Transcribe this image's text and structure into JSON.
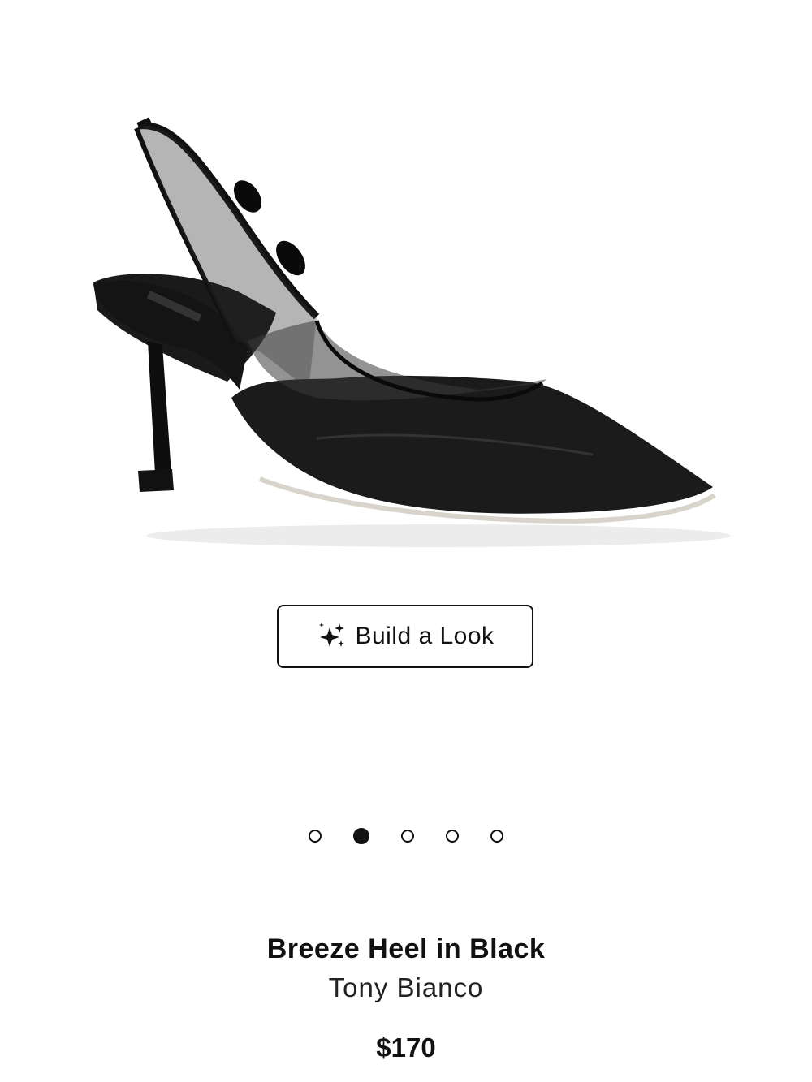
{
  "product": {
    "image_alt": "Breeze Heel in Black",
    "title": "Breeze Heel in Black",
    "brand": "Tony Bianco",
    "price": "$170"
  },
  "build_look": {
    "label": "Build a Look",
    "icon": "sparkles-icon"
  },
  "gallery": {
    "total_images": 5,
    "active_index": 1
  },
  "colors": {
    "text": "#111111",
    "background": "#ffffff"
  }
}
